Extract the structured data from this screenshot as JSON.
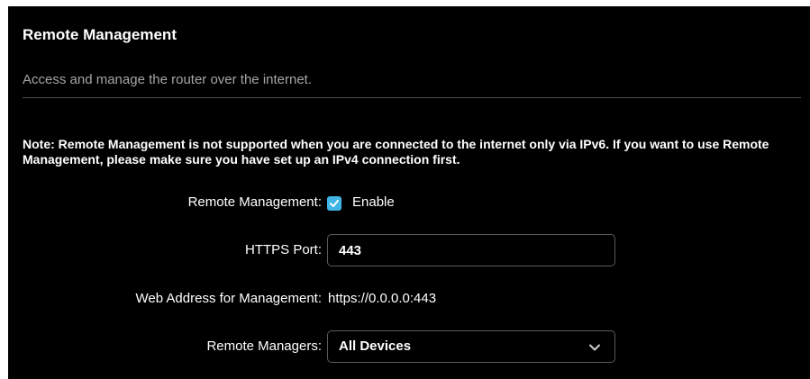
{
  "section": {
    "title": "Remote Management",
    "subtitle": "Access and manage the router over the internet."
  },
  "note": {
    "label": "Note:",
    "text": " Remote Management is not supported when you are connected to the internet only via IPv6. If you want to use Remote Management, please make sure you have set up an IPv4 connection first."
  },
  "form": {
    "remote_management": {
      "label": "Remote Management:",
      "checkbox_checked": true,
      "option_label": "Enable"
    },
    "https_port": {
      "label": "HTTPS Port:",
      "value": "443"
    },
    "web_address": {
      "label": "Web Address for Management:",
      "value": "https://0.0.0.0:443"
    },
    "remote_managers": {
      "label": "Remote Managers:",
      "selected": "All Devices"
    }
  },
  "colors": {
    "background": "#000000",
    "accent": "#41b6e6",
    "subtitle": "#a6a6a6",
    "border": "#5a5a5a"
  },
  "icons": {
    "checkbox": "checkmark-icon",
    "select": "chevron-down-icon"
  }
}
